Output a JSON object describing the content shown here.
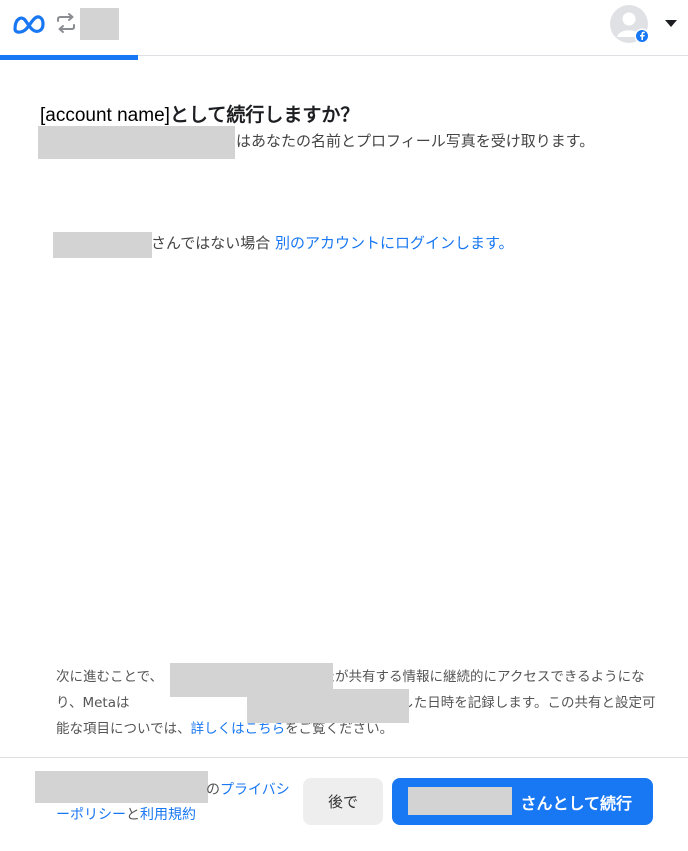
{
  "header": {
    "logo_icon": "meta-logo-icon",
    "sync_icon": "sync-arrows-icon",
    "avatar_icon": "facebook-avatar-icon",
    "dropdown_icon": "caret-down-icon",
    "brand_color": "#1877f2"
  },
  "dialog": {
    "title_account": "[account name]",
    "title_suffix": "として続行しますか？",
    "description": "はあなたの名前とプロフィール写真を受け取ります。",
    "not_you_prefix": "さんではない場合",
    "not_you_link": "別のアカウントにログインします。"
  },
  "consent": {
    "part1": "次に進むことで、",
    "part2": "はあなたが共有する情報に継続的にアクセスできるようになり、Metaは",
    "part3": "その情報にアクセスした日時を記録します。この共有と設定可能な項目についでは、",
    "learn_more_link": "詳しくはこちら",
    "part4": "をご覧ください。"
  },
  "footer": {
    "policy_prefix": "の",
    "privacy_link": "プライバシーポリシー",
    "and": "と",
    "terms_link": "利用規約",
    "later_button": "後で",
    "continue_suffix": "さんとして続行"
  }
}
